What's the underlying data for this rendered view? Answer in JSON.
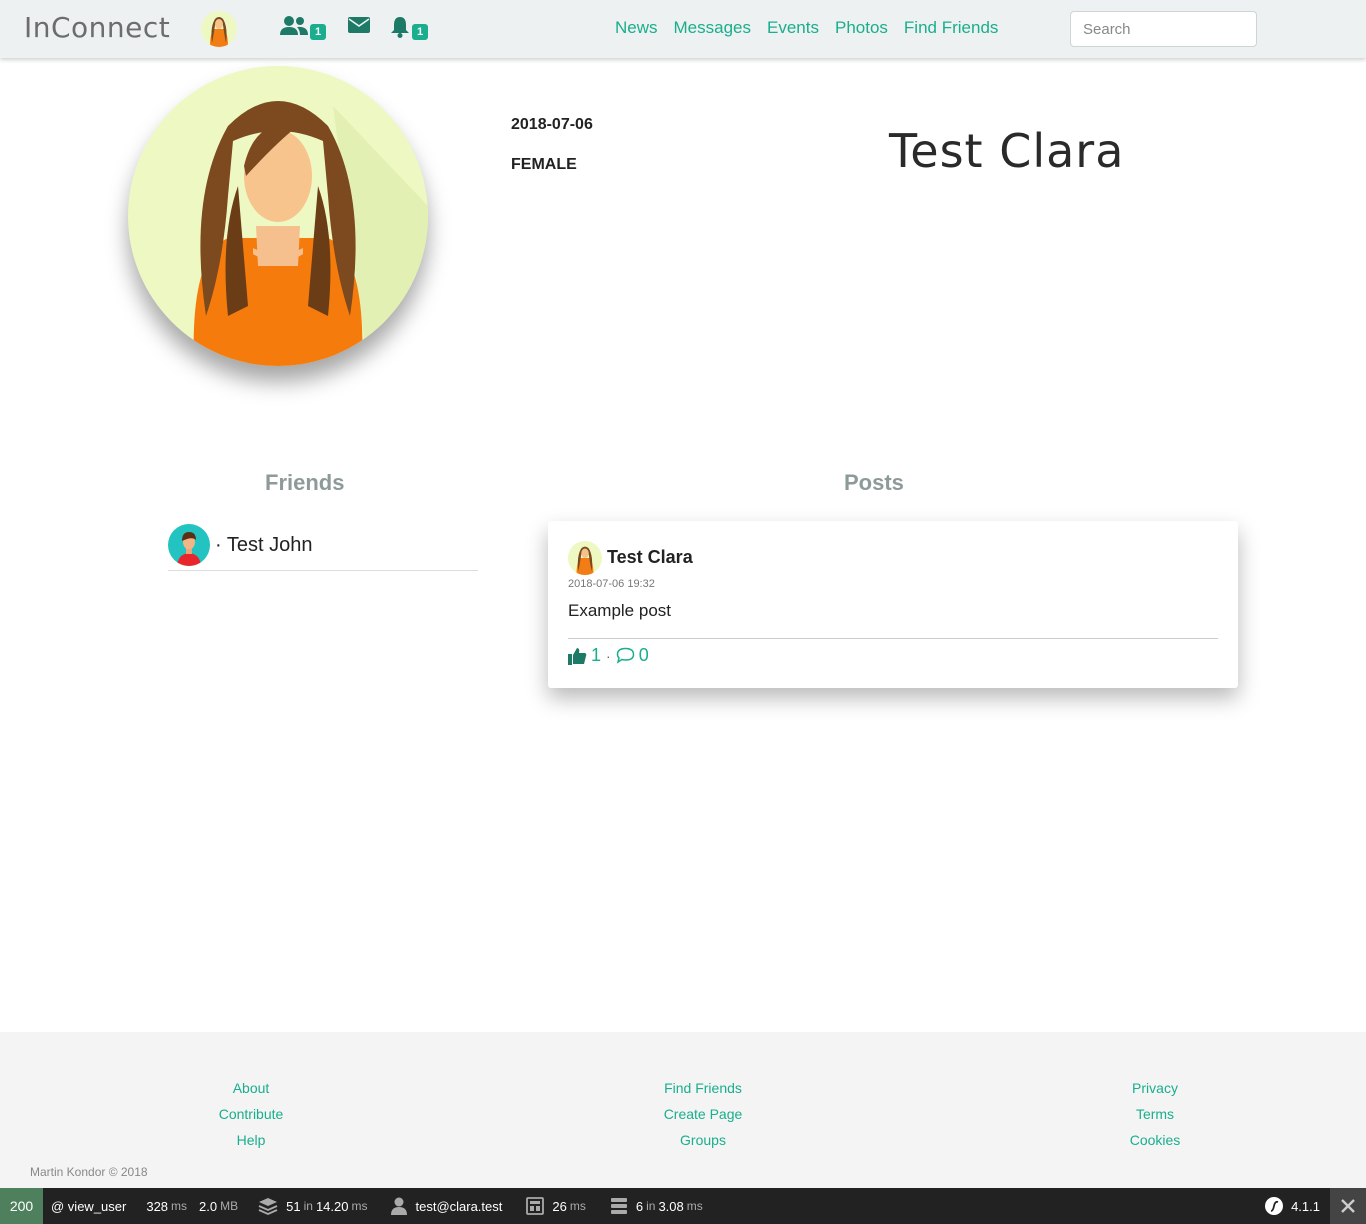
{
  "navbar": {
    "brand": "InConnect",
    "friend_requests_badge": "1",
    "notifications_badge": "1",
    "links": [
      "News",
      "Messages",
      "Events",
      "Photos",
      "Find Friends"
    ],
    "search_placeholder": "Search"
  },
  "profile": {
    "birthdate": "2018-07-06",
    "gender": "FEMALE",
    "name": "Test Clara"
  },
  "friends": {
    "title": "Friends",
    "items": [
      {
        "name": "· Test John"
      }
    ]
  },
  "posts": {
    "title": "Posts",
    "items": [
      {
        "author": "Test Clara",
        "date": "2018-07-06 19:32",
        "body": "Example post",
        "likes": "1",
        "sep": "·",
        "comments": "0"
      }
    ]
  },
  "footer": {
    "col1": [
      "About",
      "Contribute",
      "Help"
    ],
    "col2": [
      "Find Friends",
      "Create Page",
      "Groups"
    ],
    "col3": [
      "Privacy",
      "Terms",
      "Cookies"
    ],
    "copyright": "Martin Kondor © 2018"
  },
  "toolbar": {
    "status": "200",
    "route": "@ view_user",
    "time": "328",
    "time_unit": "ms",
    "memory": "2.0",
    "memory_unit": "MB",
    "forms_count": "51",
    "forms_in": "in",
    "forms_time": "14.20",
    "forms_unit": "ms",
    "user": "test@clara.test",
    "twig_time": "26",
    "twig_unit": "ms",
    "db_count": "6",
    "db_in": "in",
    "db_time": "3.08",
    "db_unit": "ms",
    "version": "4.1.1"
  },
  "colors": {
    "accent": "#1aae8e",
    "navbar_bg": "#eef1f1",
    "footer_bg": "#f4f4f4",
    "toolbar_bg": "#222222",
    "status_green": "#4f805d"
  }
}
